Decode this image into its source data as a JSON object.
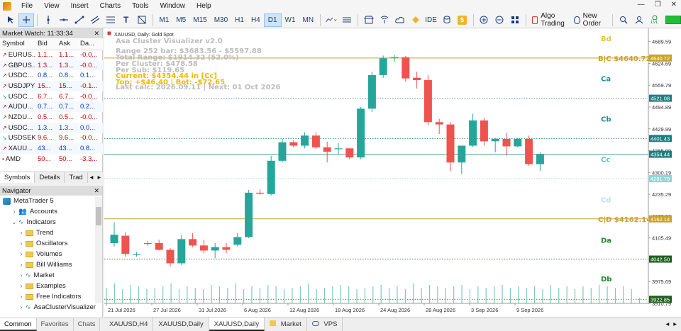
{
  "menu": [
    "File",
    "View",
    "Insert",
    "Charts",
    "Tools",
    "Window",
    "Help"
  ],
  "toolbar": {
    "timeframes": [
      "M1",
      "M5",
      "M15",
      "M30",
      "H1",
      "H4",
      "D1",
      "W1",
      "MN"
    ],
    "active_timeframe": "D1",
    "ide_label": "IDE",
    "algo_label": "Algo Trading",
    "order_label": "New Order",
    "lvl_label": "LVL"
  },
  "market_watch": {
    "title": "Market Watch: 11:33:34",
    "columns": [
      "Symbol",
      "Bid",
      "Ask",
      "Da..."
    ],
    "rows": [
      {
        "symbol": "EURUS...",
        "bid": "1.1...",
        "ask": "1.1...",
        "day": "-0.0...",
        "dir": "up"
      },
      {
        "symbol": "GBPUS...",
        "bid": "1.3...",
        "ask": "1.3...",
        "day": "-0.0...",
        "dir": "up"
      },
      {
        "symbol": "USDC...",
        "bid": "0.8...",
        "ask": "0.8...",
        "day": "0.1...",
        "dir": "up"
      },
      {
        "symbol": "USDJPY",
        "bid": "15...",
        "ask": "15...",
        "day": "-0.1...",
        "dir": "up"
      },
      {
        "symbol": "USDC...",
        "bid": "6.7...",
        "ask": "6.7...",
        "day": "-0.0...",
        "dir": "down"
      },
      {
        "symbol": "AUDU...",
        "bid": "0.7...",
        "ask": "0.7...",
        "day": "0.2...",
        "dir": "up"
      },
      {
        "symbol": "NZDU...",
        "bid": "0.5...",
        "ask": "0.5...",
        "day": "-0.0...",
        "dir": "up"
      },
      {
        "symbol": "USDC...",
        "bid": "1.3...",
        "ask": "1.3...",
        "day": "0.0...",
        "dir": "up"
      },
      {
        "symbol": "USDSEK",
        "bid": "9.6...",
        "ask": "9.6...",
        "day": "-0.0...",
        "dir": "down"
      },
      {
        "symbol": "XAUU...",
        "bid": "43...",
        "ask": "43...",
        "day": "0.8...",
        "dir": "up"
      },
      {
        "symbol": "AMD",
        "bid": "50...",
        "ask": "50...",
        "day": "-3.3...",
        "dir": "none"
      }
    ],
    "tabs": [
      "Symbols",
      "Details",
      "Trad"
    ]
  },
  "navigator": {
    "title": "Navigator",
    "items": [
      {
        "label": "MetaTrader 5",
        "level": 0,
        "icon": "mt5-logo-icon"
      },
      {
        "label": "Accounts",
        "level": 1,
        "icon": "accounts-icon"
      },
      {
        "label": "Indicators",
        "level": 1,
        "icon": "indicators-icon"
      },
      {
        "label": "Trend",
        "level": 2,
        "icon": "folder-icon"
      },
      {
        "label": "Oscillators",
        "level": 2,
        "icon": "folder-icon"
      },
      {
        "label": "Volumes",
        "level": 2,
        "icon": "folder-icon"
      },
      {
        "label": "Bill Williams",
        "level": 2,
        "icon": "folder-icon"
      },
      {
        "label": "Market",
        "level": 2,
        "icon": "market-icon"
      },
      {
        "label": "Examples",
        "level": 2,
        "icon": "folder-icon"
      },
      {
        "label": "Free Indicators",
        "level": 2,
        "icon": "folder-icon"
      },
      {
        "label": "AsaClusterVisualizer",
        "level": 2,
        "icon": "indicator-icon"
      }
    ],
    "bottom_tabs": [
      "Common",
      "Favorites",
      "Chats"
    ]
  },
  "chart": {
    "symbol_caption": "XAUUSD, Daily:  Gold Spot",
    "indicator": {
      "title": "Asa Cluster Visualizer v2.0",
      "range": "Range 252 bar:  $3683.56 - $5597.88",
      "total_range": "Total Range:   $1914.32 (52.0%)",
      "per_cluster": "Per Cluster:   $478.58",
      "per_sub": "Per Sub:       $119.65",
      "current": "Current: $4354.44 in [Cc]",
      "top_bot": "Top: +$46.40 | Bot: -$72.65",
      "last_calc": "Last calc: 2026.09.11 | Next: 01 Oct 2026"
    },
    "zone_labels": [
      {
        "text": "Bd",
        "price": 4700,
        "color": "#e6c34a"
      },
      {
        "text": "Ca",
        "price": 4580,
        "color": "#1b8f8f"
      },
      {
        "text": "Cb",
        "price": 4460,
        "color": "#1b8f8f"
      },
      {
        "text": "Cc",
        "price": 4340,
        "color": "#52c8c8"
      },
      {
        "text": "Cd",
        "price": 4220,
        "color": "#b6e6e6"
      },
      {
        "text": "Da",
        "price": 4100,
        "color": "#1f8a2e"
      },
      {
        "text": "Db",
        "price": 3985,
        "color": "#1f8a2e"
      }
    ],
    "boundary_labels": [
      {
        "text": "B|C  $4640.72",
        "price": 4640.72
      },
      {
        "text": "C|D  $4162.14",
        "price": 4162.14
      }
    ],
    "price_tags": [
      {
        "text": "4640.72",
        "price": 4640.72,
        "bg": "#c9a227",
        "fg": "#ffffff"
      },
      {
        "text": "4521.08",
        "price": 4521.08,
        "bg": "#1b7f7f",
        "fg": "#ffffff"
      },
      {
        "text": "4401.43",
        "price": 4401.43,
        "bg": "#1b7f7f",
        "fg": "#ffffff"
      },
      {
        "text": "4354.44",
        "price": 4354.44,
        "bg": "#1b7f7f",
        "fg": "#ffffff"
      },
      {
        "text": "4281.79",
        "price": 4281.79,
        "bg": "#8fd6d6",
        "fg": "#ffffff"
      },
      {
        "text": "4162.14",
        "price": 4162.14,
        "bg": "#c9a227",
        "fg": "#ffffff"
      },
      {
        "text": "4042.50",
        "price": 4042.5,
        "bg": "#1f5f1f",
        "fg": "#ffffff"
      },
      {
        "text": "3922.85",
        "price": 3922.85,
        "bg": "#1f5f1f",
        "fg": "#ffffff"
      }
    ],
    "bottom_tabs": [
      "XAUUSD,H4",
      "XAUUSD,Daily",
      "XAUUSD,Daily",
      "Market",
      "VPS"
    ],
    "active_tab_index": 2
  },
  "chart_data": {
    "type": "candlestick",
    "y_ticks": [
      4689.59,
      4624.69,
      4559.79,
      4494.89,
      4429.99,
      4365.09,
      4300.19,
      4235.29,
      4170.39,
      4105.49,
      4040.59,
      3975.69,
      3910.79
    ],
    "x_labels": [
      "21 Jul 2026",
      "27 Jul 2026",
      "31 Jul 2026",
      "6 Aug 2026",
      "12 Aug 2026",
      "18 Aug 2026",
      "24 Aug 2026",
      "28 Aug 2026",
      "3 Sep 2026",
      "9 Sep 2026"
    ],
    "ylim": [
      3910.79,
      4729
    ],
    "grid": false,
    "candles": [
      [
        4090,
        4152,
        4080,
        4115
      ],
      [
        4112,
        4122,
        4050,
        4058
      ],
      [
        4058,
        4064,
        4050,
        4058
      ],
      [
        4090,
        4097,
        4082,
        4088
      ],
      [
        4090,
        4100,
        4068,
        4070
      ],
      [
        4070,
        4075,
        4020,
        4030
      ],
      [
        4030,
        4115,
        4025,
        4102
      ],
      [
        4102,
        4120,
        4078,
        4083
      ],
      [
        4083,
        4100,
        4060,
        4068
      ],
      [
        4068,
        4090,
        4045,
        4078
      ],
      [
        4078,
        4090,
        4060,
        4070
      ],
      [
        4085,
        4120,
        4080,
        4108
      ],
      [
        4108,
        4248,
        4105,
        4240
      ],
      [
        4240,
        4250,
        4234,
        4237
      ],
      [
        4236,
        4350,
        4232,
        4335
      ],
      [
        4335,
        4400,
        4330,
        4390
      ],
      [
        4390,
        4396,
        4375,
        4380
      ],
      [
        4380,
        4420,
        4372,
        4410
      ],
      [
        4410,
        4420,
        4370,
        4375
      ],
      [
        4375,
        4392,
        4330,
        4362
      ],
      [
        4370,
        4388,
        4355,
        4372
      ],
      [
        4372,
        4372,
        4340,
        4345
      ],
      [
        4345,
        4495,
        4340,
        4490
      ],
      [
        4490,
        4600,
        4480,
        4590
      ],
      [
        4590,
        4648,
        4582,
        4640
      ],
      [
        4640,
        4650,
        4630,
        4643
      ],
      [
        4643,
        4647,
        4570,
        4580
      ],
      [
        4582,
        4600,
        4550,
        4575
      ],
      [
        4575,
        4590,
        4440,
        4450
      ],
      [
        4450,
        4460,
        4415,
        4443
      ],
      [
        4443,
        4450,
        4305,
        4330
      ],
      [
        4330,
        4370,
        4295,
        4380
      ],
      [
        4380,
        4475,
        4375,
        4455
      ],
      [
        4455,
        4462,
        4380,
        4393
      ],
      [
        4393,
        4403,
        4360,
        4400
      ],
      [
        4400,
        4418,
        4350,
        4378
      ],
      [
        4378,
        4403,
        4375,
        4400
      ],
      [
        4400,
        4410,
        4320,
        4325
      ],
      [
        4325,
        4360,
        4305,
        4354
      ]
    ],
    "volumes": [
      0.55,
      0.7,
      0.5,
      0.65,
      0.6,
      0.5,
      0.55,
      0.6,
      0.7,
      0.5,
      0.6,
      0.55,
      0.5,
      0.65,
      0.6,
      0.55,
      0.7,
      0.5,
      0.6,
      0.55,
      0.65,
      0.6,
      0.5,
      0.55,
      0.6,
      0.7,
      0.5,
      0.55,
      0.6,
      0.65,
      0.6,
      0.5,
      0.55,
      0.6,
      0.65,
      0.55,
      0.6,
      0.5,
      0.7,
      0.55,
      0.65,
      0.6,
      0.55,
      0.6,
      0.65,
      0.5,
      0.6,
      0.55,
      0.6,
      0.65,
      0.55,
      0.6,
      0.55,
      0.6,
      0.5,
      0.65,
      0.55,
      0.6,
      0.5,
      0.6,
      0.55,
      0.65,
      0.6,
      0.55,
      0.6,
      0.5,
      0.2
    ]
  },
  "colors": {
    "bull": "#26a69a",
    "bear": "#ef5350",
    "bc_line": "#c9a227",
    "cluster_line": "#1b7f7f"
  }
}
